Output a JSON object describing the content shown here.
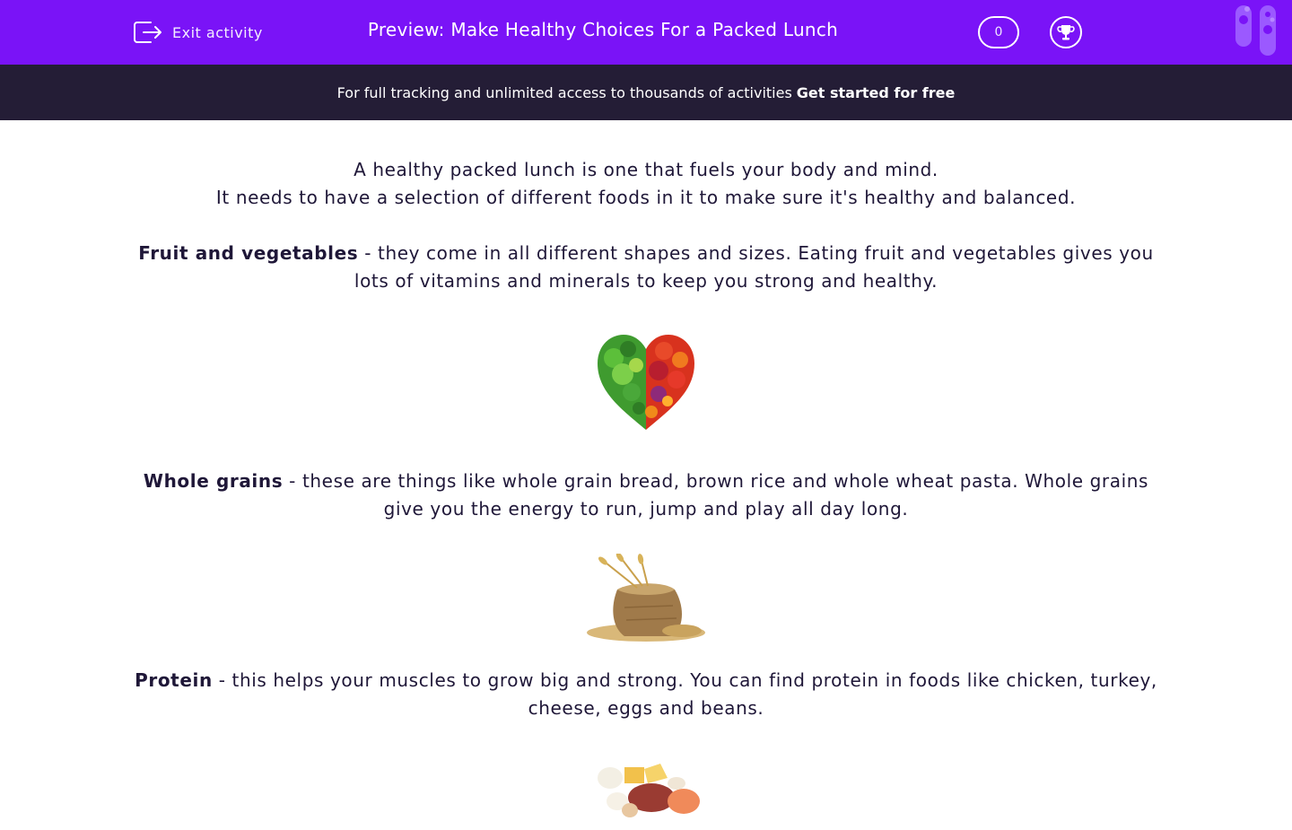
{
  "header": {
    "exit_label": "Exit activity",
    "title": "Preview: Make Healthy Choices For a Packed Lunch",
    "score": "0",
    "accent_color": "#7a13f7"
  },
  "banner": {
    "text": "For full tracking and unlimited access to thousands of activities",
    "cta": "Get started for free",
    "background_color": "#241d36"
  },
  "content": {
    "intro_line1": "A healthy packed lunch is one that fuels your body and mind.",
    "intro_line2": "It needs to have a selection of different foods in it to make sure it's healthy and balanced.",
    "sections": [
      {
        "heading": "Fruit and vegetables",
        "text": " - they come in all different shapes and sizes.  Eating fruit and vegetables gives you lots of vitamins and minerals to keep you strong and healthy.",
        "image": "fruit-vegetable-heart"
      },
      {
        "heading": "Whole grains",
        "text": "  - these are things like whole grain bread, brown rice and whole wheat pasta.  Whole grains give you the energy to run, jump and play all day long.",
        "image": "grain-sack"
      },
      {
        "heading": "Protein",
        "text": " - this helps your muscles to grow big and strong. You can find protein in foods like chicken, turkey, cheese, eggs and beans.",
        "image": "protein-foods"
      }
    ]
  },
  "icons": {
    "exit": "exit-icon",
    "trophy": "trophy-icon",
    "tubes": "test-tubes-icon"
  }
}
